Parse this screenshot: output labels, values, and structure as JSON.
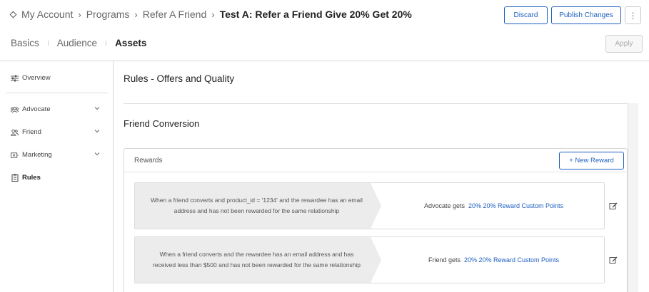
{
  "breadcrumb": {
    "items": [
      "My Account",
      "Programs",
      "Refer A Friend"
    ],
    "current": "Test A: Refer a Friend Give 20% Get 20%"
  },
  "header_actions": {
    "discard": "Discard",
    "publish": "Publish Changes",
    "more": "⋮",
    "apply": "Apply"
  },
  "tabs": [
    {
      "label": "Basics",
      "active": false
    },
    {
      "label": "Audience",
      "active": false
    },
    {
      "label": "Assets",
      "active": true
    }
  ],
  "sidebar": {
    "items": [
      {
        "label": "Overview",
        "icon": "sliders-icon",
        "expandable": false
      },
      {
        "label": "Advocate",
        "icon": "group-icon",
        "expandable": true
      },
      {
        "label": "Friend",
        "icon": "users-icon",
        "expandable": true
      },
      {
        "label": "Marketing",
        "icon": "marketing-icon",
        "expandable": true
      },
      {
        "label": "Rules",
        "icon": "clipboard-icon",
        "expandable": false
      }
    ]
  },
  "main": {
    "title": "Rules - Offers and Quality",
    "section_title": "Friend Conversion",
    "rewards": {
      "label": "Rewards",
      "new_button": "+ New Reward",
      "rows": [
        {
          "condition": "When a friend converts and product_id = '1234' and the rewardee has an email address and has not been rewarded for the same relationship",
          "recipient": "Advocate gets",
          "reward": "20% 20% Reward Custom Points"
        },
        {
          "condition": "When a friend converts and the rewardee has an email address and has received less than $500 and has not been rewarded for the same relationship",
          "recipient": "Friend gets",
          "reward": "20% 20% Reward Custom Points"
        }
      ]
    }
  },
  "colors": {
    "accent": "#1f5fbf",
    "condition_bg": "#ececec",
    "border": "#d8d8d8"
  }
}
